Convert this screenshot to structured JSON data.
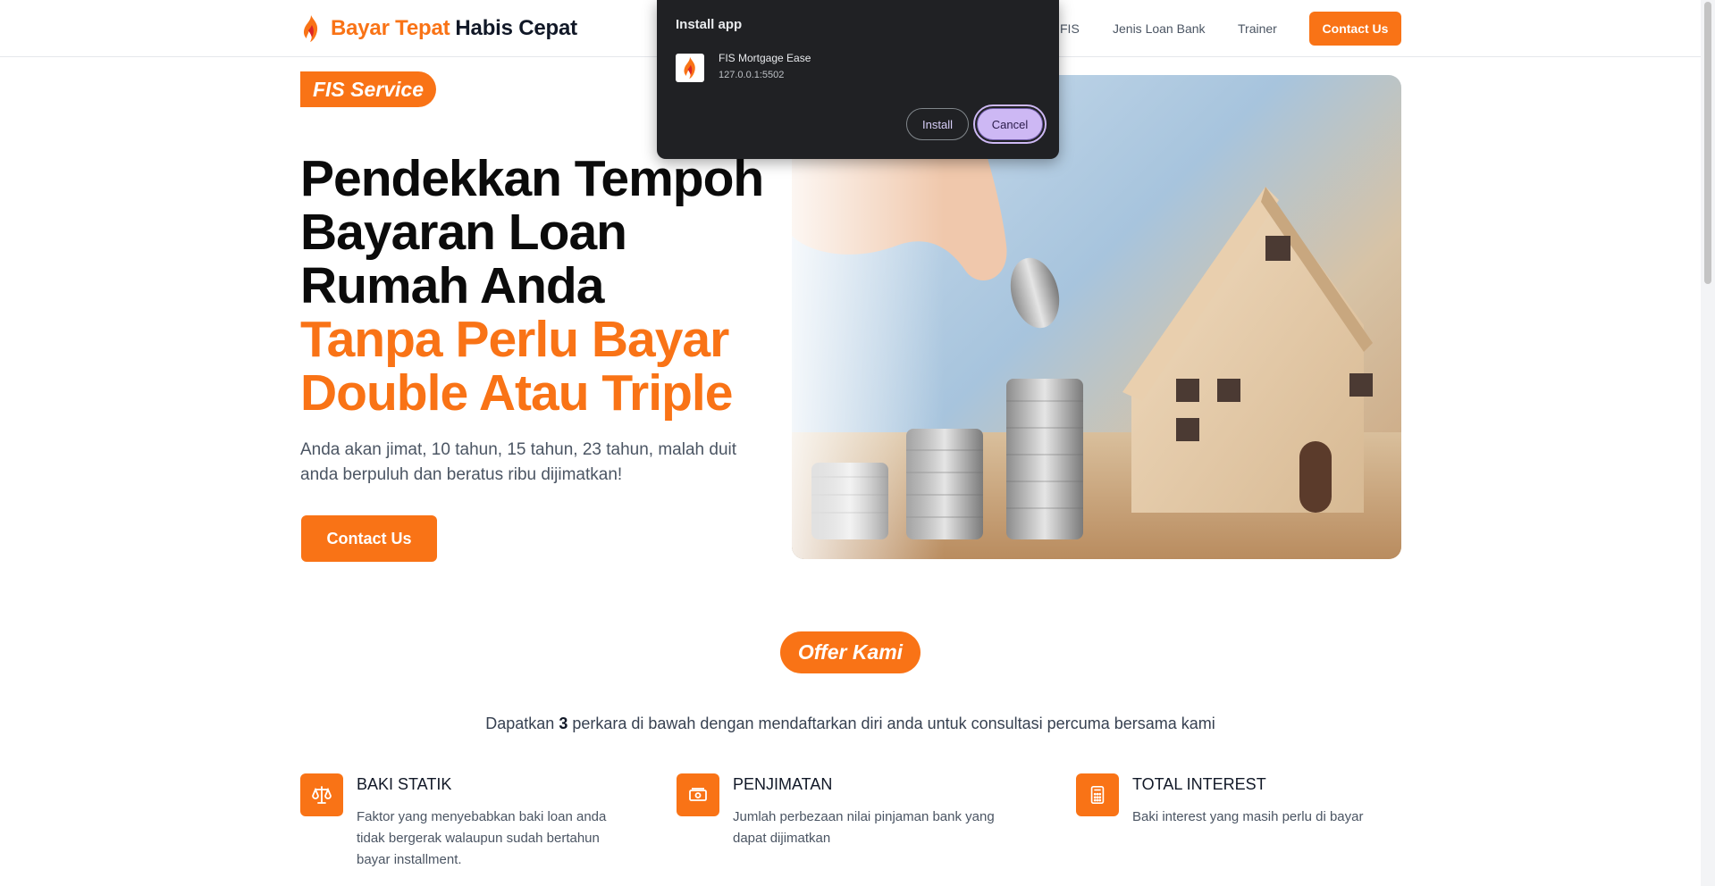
{
  "colors": {
    "accent": "#f97316",
    "dialog_bg": "#202124",
    "cancel_bg": "#cdb8f4"
  },
  "header": {
    "brand_orange": "Bayar Tepat",
    "brand_dark": "Habis Cepat",
    "logo_icon": "flame-icon",
    "nav": [
      "FIS",
      "Jenis Loan Bank",
      "Trainer"
    ],
    "contact_label": "Contact Us"
  },
  "hero": {
    "badge": "FIS Service",
    "title_dark": [
      "Pendekkan Tempoh",
      "Bayaran Loan",
      "Rumah Anda"
    ],
    "title_orange": [
      "Tanpa Perlu Bayar",
      "Double Atau Triple"
    ],
    "subtitle": "Anda akan jimat, 10 tahun, 15 tahun, 23 tahun, malah duit anda berpuluh dan beratus ribu dijimatkan!",
    "cta": "Contact Us",
    "image_alt": "hand placing coin on stacks beside wooden house"
  },
  "offer": {
    "badge": "Offer Kami",
    "sub_before": "Dapatkan ",
    "sub_count": "3",
    "sub_after": " perkara di bawah dengan mendaftarkan diri anda untuk consultasi percuma bersama kami",
    "features": [
      {
        "icon": "scale-icon",
        "title": "BAKI STATIK",
        "desc": "Faktor yang menyebabkan baki loan anda tidak bergerak walaupun sudah bertahun bayar installment."
      },
      {
        "icon": "money-icon",
        "title": "PENJIMATAN",
        "desc": "Jumlah perbezaan nilai pinjaman bank yang dapat dijimatkan"
      },
      {
        "icon": "calculator-icon",
        "title": "TOTAL INTEREST",
        "desc": "Baki interest yang masih perlu di bayar"
      }
    ]
  },
  "install_dialog": {
    "title": "Install app",
    "app_name": "FIS Mortgage Ease",
    "app_url": "127.0.0.1:5502",
    "install_label": "Install",
    "cancel_label": "Cancel"
  }
}
